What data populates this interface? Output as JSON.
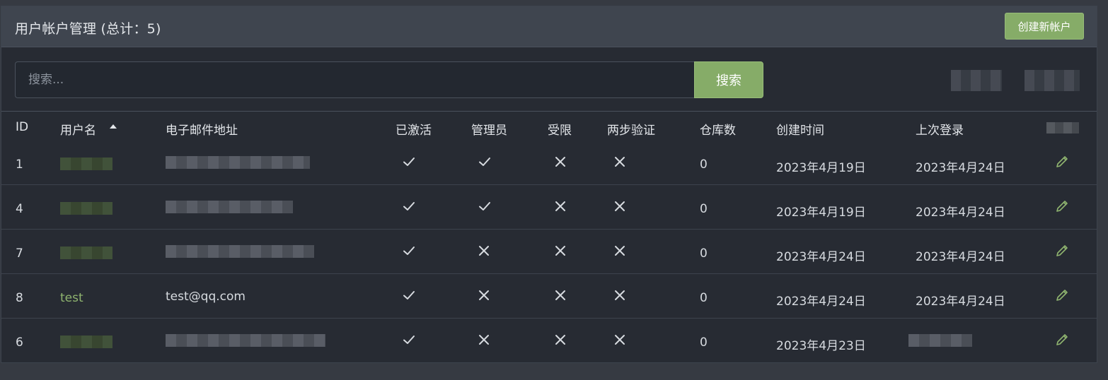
{
  "header": {
    "title": "用户帐户管理 (总计：5)",
    "create_button": "创建新帐户"
  },
  "search": {
    "placeholder": "搜索...",
    "button": "搜索"
  },
  "table": {
    "columns": [
      "ID",
      "用户名",
      "电子邮件地址",
      "已激活",
      "管理员",
      "受限",
      "两步验证",
      "仓库数",
      "创建时间",
      "上次登录"
    ],
    "sorted_column": "用户名",
    "rows": [
      {
        "id": "1",
        "username": "",
        "email": "",
        "activated": "✓",
        "admin": "✓",
        "restricted": "✕",
        "two_factor": "✕",
        "repos": "0",
        "created": "2023年4月19日",
        "last_login": "2023年4月24日"
      },
      {
        "id": "4",
        "username": "",
        "email": "",
        "activated": "✓",
        "admin": "✓",
        "restricted": "✕",
        "two_factor": "✕",
        "repos": "0",
        "created": "2023年4月19日",
        "last_login": "2023年4月24日"
      },
      {
        "id": "7",
        "username": "",
        "email": "",
        "activated": "✓",
        "admin": "✕",
        "restricted": "✕",
        "two_factor": "✕",
        "repos": "0",
        "created": "2023年4月24日",
        "last_login": "2023年4月24日"
      },
      {
        "id": "8",
        "username": "test",
        "email": "test@qq.com",
        "activated": "✓",
        "admin": "✕",
        "restricted": "✕",
        "two_factor": "✕",
        "repos": "0",
        "created": "2023年4月24日",
        "last_login": "2023年4月24日"
      },
      {
        "id": "6",
        "username": "",
        "email": "",
        "activated": "✓",
        "admin": "✕",
        "restricted": "✕",
        "two_factor": "✕",
        "repos": "0",
        "created": "2023年4月23日",
        "last_login": ""
      }
    ]
  },
  "colors": {
    "accent": "#86ac68",
    "username": "#8fb46f",
    "background": "#272b33"
  },
  "icons": {
    "edit": "pencil-icon",
    "check": "check-icon",
    "cross": "cross-icon"
  }
}
